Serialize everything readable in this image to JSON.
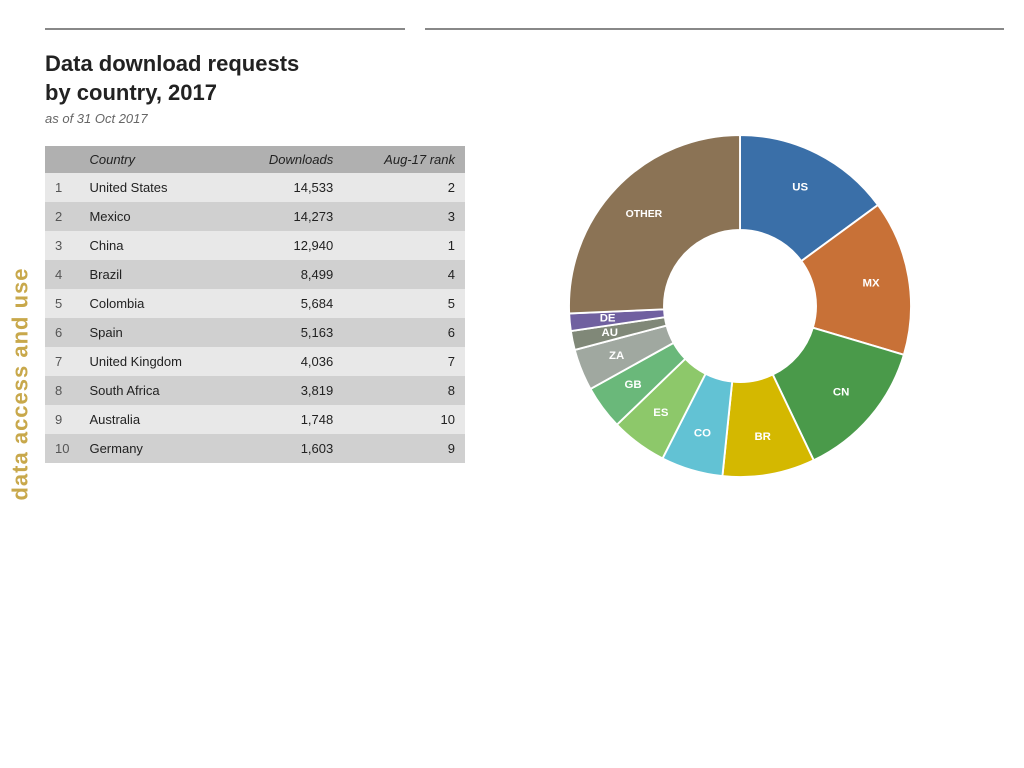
{
  "sidebar": {
    "label": "data access and use"
  },
  "header": {
    "title": "Data download requests\nby country, 2017",
    "subtitle": "as of 31 Oct 2017"
  },
  "table": {
    "columns": [
      "",
      "Country",
      "Downloads",
      "Aug-17 rank"
    ],
    "rows": [
      {
        "rank": "1",
        "country": "United States",
        "downloads": "14,533",
        "aug_rank": "2"
      },
      {
        "rank": "2",
        "country": "Mexico",
        "downloads": "14,273",
        "aug_rank": "3"
      },
      {
        "rank": "3",
        "country": "China",
        "downloads": "12,940",
        "aug_rank": "1"
      },
      {
        "rank": "4",
        "country": "Brazil",
        "downloads": "8,499",
        "aug_rank": "4"
      },
      {
        "rank": "5",
        "country": "Colombia",
        "downloads": "5,684",
        "aug_rank": "5"
      },
      {
        "rank": "6",
        "country": "Spain",
        "downloads": "5,163",
        "aug_rank": "6"
      },
      {
        "rank": "7",
        "country": "United Kingdom",
        "downloads": "4,036",
        "aug_rank": "7"
      },
      {
        "rank": "8",
        "country": "South Africa",
        "downloads": "3,819",
        "aug_rank": "8"
      },
      {
        "rank": "9",
        "country": "Australia",
        "downloads": "1,748",
        "aug_rank": "10"
      },
      {
        "rank": "10",
        "country": "Germany",
        "downloads": "1,603",
        "aug_rank": "9"
      }
    ]
  },
  "chart": {
    "segments": [
      {
        "label": "US",
        "color": "#3a6fa8",
        "value": 14533
      },
      {
        "label": "MX",
        "color": "#c87137",
        "value": 14273
      },
      {
        "label": "CN",
        "color": "#4a9a4a",
        "value": 12940
      },
      {
        "label": "BR",
        "color": "#d4b800",
        "value": 8499
      },
      {
        "label": "CO",
        "color": "#62c2d4",
        "value": 5684
      },
      {
        "label": "ES",
        "color": "#8dc86a",
        "value": 5163
      },
      {
        "label": "GB",
        "color": "#6ab87a",
        "value": 4036
      },
      {
        "label": "ZA",
        "color": "#a0a8a0",
        "value": 3819
      },
      {
        "label": "AU",
        "color": "#808878",
        "value": 1748
      },
      {
        "label": "DE",
        "color": "#7060a0",
        "value": 1603
      },
      {
        "label": "OTHER",
        "color": "#8b7355",
        "value": 25000
      }
    ]
  }
}
